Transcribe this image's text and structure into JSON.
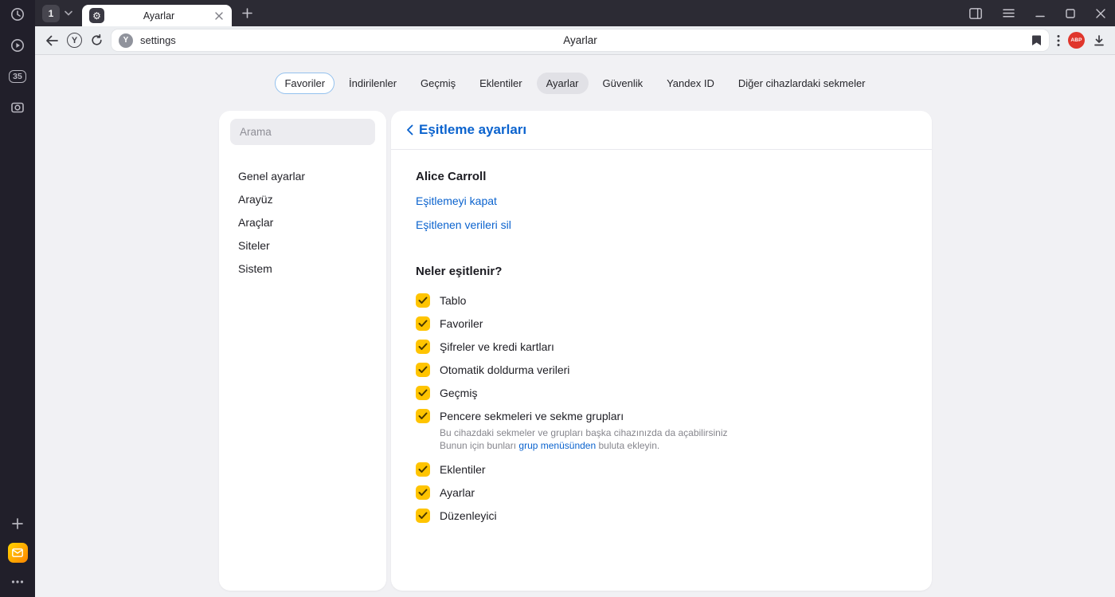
{
  "rail": {
    "tab_count": "35"
  },
  "tab_bar": {
    "tab_stack_number": "1",
    "active_tab_title": "Ayarlar"
  },
  "toolbar": {
    "yandex_letter": "Y",
    "favicon_letter": "Y",
    "address_value": "settings",
    "page_title": "Ayarlar",
    "adblock_label": "ABP"
  },
  "nav_tabs": [
    {
      "label": "Favoriler",
      "state": "outlined"
    },
    {
      "label": "İndirilenler",
      "state": "normal"
    },
    {
      "label": "Geçmiş",
      "state": "normal"
    },
    {
      "label": "Eklentiler",
      "state": "normal"
    },
    {
      "label": "Ayarlar",
      "state": "active"
    },
    {
      "label": "Güvenlik",
      "state": "normal"
    },
    {
      "label": "Yandex ID",
      "state": "normal"
    },
    {
      "label": "Diğer cihazlardaki sekmeler",
      "state": "normal"
    }
  ],
  "sidebar": {
    "search_placeholder": "Arama",
    "items": [
      "Genel ayarlar",
      "Arayüz",
      "Araçlar",
      "Siteler",
      "Sistem"
    ]
  },
  "main": {
    "header_title": "Eşitleme ayarları",
    "account_name": "Alice Carroll",
    "link_disable_sync": "Eşitlemeyi kapat",
    "link_delete_synced": "Eşitlenen verileri sil",
    "section_title": "Neler eşitlenir?",
    "checkboxes": [
      {
        "label": "Tablo",
        "checked": true
      },
      {
        "label": "Favoriler",
        "checked": true
      },
      {
        "label": "Şifreler ve kredi kartları",
        "checked": true
      },
      {
        "label": "Otomatik doldurma verileri",
        "checked": true
      },
      {
        "label": "Geçmiş",
        "checked": true
      },
      {
        "label": "Pencere sekmeleri ve sekme grupları",
        "checked": true,
        "description_line1": "Bu cihazdaki sekmeler ve grupları başka cihazınızda da açabilirsiniz",
        "description_line2_prefix": "Bunun için bunları ",
        "description_link": "grup menüsünden",
        "description_line2_suffix": " buluta ekleyin."
      },
      {
        "label": "Eklentiler",
        "checked": true
      },
      {
        "label": "Ayarlar",
        "checked": true
      },
      {
        "label": "Düzenleyici",
        "checked": true
      }
    ]
  },
  "colors": {
    "accent_blue": "#0b63ce",
    "checkbox_yellow": "#ffc400",
    "adblock_red": "#e0362c",
    "mail_orange": "#ff9000",
    "rail_dark": "#211f2a",
    "tabbar_dark": "#2c2b34"
  }
}
